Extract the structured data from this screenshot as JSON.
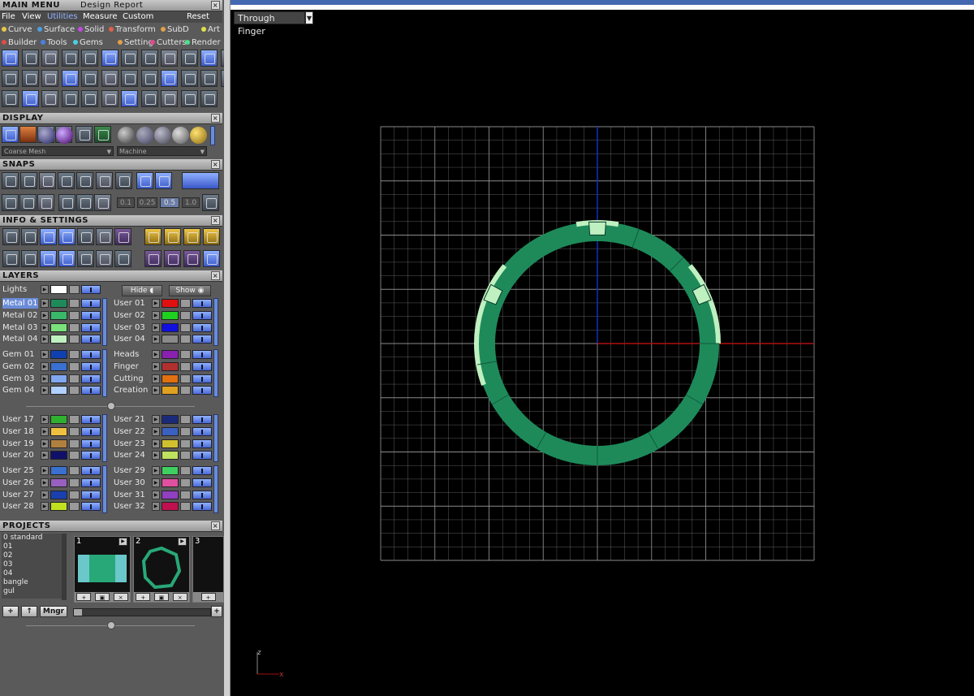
{
  "main_menu": {
    "title": "MAIN MENU",
    "report": "Design Report",
    "menubar": [
      "File",
      "View",
      "Utilities",
      "Measure",
      "Custom"
    ],
    "reset": "Reset"
  },
  "categories_row1": [
    {
      "label": "Curve",
      "color": "#e6c84a"
    },
    {
      "label": "Surface",
      "color": "#4aa0e0"
    },
    {
      "label": "Solid",
      "color": "#c04ae0"
    },
    {
      "label": "Transform",
      "color": "#e0604a"
    },
    {
      "label": "SubD",
      "color": "#e0a04a"
    },
    {
      "label": "Art",
      "color": "#e0e04a"
    }
  ],
  "categories_row2": [
    {
      "label": "Builder",
      "color": "#e04a4a"
    },
    {
      "label": "Tools",
      "color": "#4a80e0"
    },
    {
      "label": "Gems",
      "color": "#4ad0e0"
    },
    {
      "label": "Setting",
      "color": "#e0a04a"
    },
    {
      "label": "Cutters",
      "color": "#e04a90"
    },
    {
      "label": "Render",
      "color": "#4ae08a"
    }
  ],
  "display": {
    "title": "DISPLAY",
    "mesh_mode": "Coarse Mesh",
    "material": "Machine"
  },
  "snaps": {
    "title": "SNAPS",
    "values": [
      "0.1",
      "0.25",
      "0.5",
      "1.0"
    ],
    "selected": "0.5"
  },
  "info": {
    "title": "INFO & SETTINGS"
  },
  "layers": {
    "title": "LAYERS",
    "lights": "Lights",
    "hide": "Hide",
    "show": "Show",
    "group1_left": [
      {
        "name": "Metal 01",
        "color": "#1e8a5a",
        "selected": true
      },
      {
        "name": "Metal 02",
        "color": "#3ab86a"
      },
      {
        "name": "Metal 03",
        "color": "#7ae07a"
      },
      {
        "name": "Metal 04",
        "color": "#bff0c0"
      }
    ],
    "group1_right": [
      {
        "name": "User 01",
        "color": "#e01010"
      },
      {
        "name": "User 02",
        "color": "#20d020"
      },
      {
        "name": "User 03",
        "color": "#1010e0"
      },
      {
        "name": "User 04",
        "color": "#8a8a8a"
      }
    ],
    "group2_left": [
      {
        "name": "Gem 01",
        "color": "#1040b0"
      },
      {
        "name": "Gem 02",
        "color": "#3a70d0"
      },
      {
        "name": "Gem 03",
        "color": "#80a8f0"
      },
      {
        "name": "Gem 04",
        "color": "#b0d0ff"
      }
    ],
    "group2_right": [
      {
        "name": "Heads",
        "color": "#8a20b0"
      },
      {
        "name": "Finger",
        "color": "#b03030"
      },
      {
        "name": "Cutting",
        "color": "#e07010"
      },
      {
        "name": "Creation",
        "color": "#e0a020"
      }
    ],
    "group3_left": [
      {
        "name": "User 17",
        "color": "#30b030"
      },
      {
        "name": "User 18",
        "color": "#f0c040"
      },
      {
        "name": "User 19",
        "color": "#b08040"
      },
      {
        "name": "User 20",
        "color": "#10106a"
      }
    ],
    "group3_right": [
      {
        "name": "User 21",
        "color": "#1a2a7a"
      },
      {
        "name": "User 22",
        "color": "#3a60c0"
      },
      {
        "name": "User 23",
        "color": "#d0c030"
      },
      {
        "name": "User 24",
        "color": "#c0e060"
      }
    ],
    "group4_left": [
      {
        "name": "User 25",
        "color": "#3a70d0"
      },
      {
        "name": "User 26",
        "color": "#9a60c0"
      },
      {
        "name": "User 27",
        "color": "#1a40b0"
      },
      {
        "name": "User 28",
        "color": "#c0e020"
      }
    ],
    "group4_right": [
      {
        "name": "User 29",
        "color": "#40d060"
      },
      {
        "name": "User 30",
        "color": "#e050a0"
      },
      {
        "name": "User 31",
        "color": "#9040c0"
      },
      {
        "name": "User 32",
        "color": "#c01050"
      }
    ]
  },
  "projects": {
    "title": "PROJECTS",
    "list": [
      "0 standard",
      "01",
      "02",
      "03",
      "04",
      "bangle",
      "gul"
    ],
    "thumbs": [
      "1",
      "2",
      "3"
    ],
    "mngr": "Mngr"
  },
  "viewport": {
    "view_name": "Through Finger"
  },
  "axis_label": {
    "z": "z",
    "x": "x"
  },
  "colors": {
    "ring_dark": "#1e8a5a",
    "ring_light": "#bff0c0",
    "grid": "#9a9a9a",
    "axis_x": "#b01010",
    "axis_y": "#1030c0"
  }
}
